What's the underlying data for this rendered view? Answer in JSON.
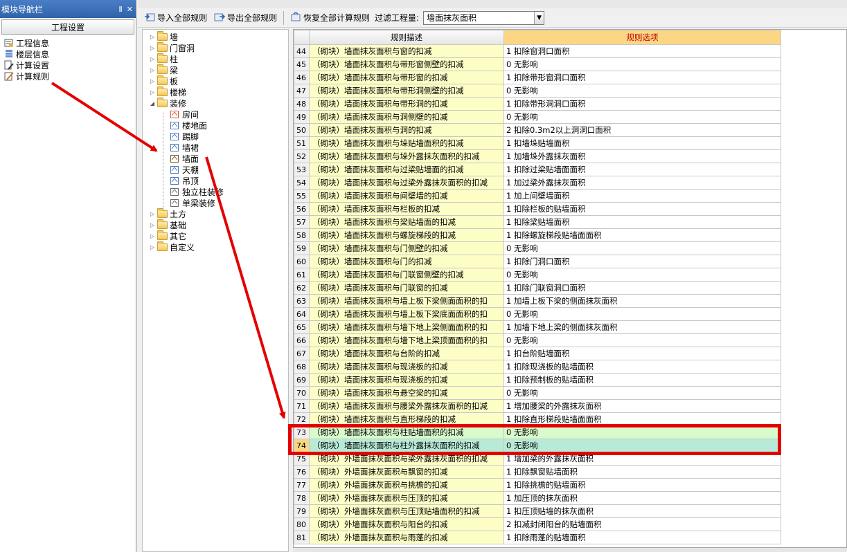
{
  "nav": {
    "title": "模块导航栏",
    "pin_glyph": "Ⅱ",
    "close_glyph": "✕",
    "header": "工程设置",
    "items": [
      {
        "label": "工程信息",
        "icon": "project-info-icon"
      },
      {
        "label": "楼层信息",
        "icon": "floor-info-icon"
      },
      {
        "label": "计算设置",
        "icon": "calc-settings-icon"
      },
      {
        "label": "计算规则",
        "icon": "calc-rules-icon"
      }
    ]
  },
  "toolbar": {
    "import_label": "导入全部规则",
    "export_label": "导出全部规则",
    "restore_label": "恢复全部计算规则",
    "filter_label": "过滤工程量:",
    "filter_value": "墙面抹灰面积"
  },
  "tree": {
    "top_items": [
      "墙",
      "门窗洞",
      "柱",
      "梁",
      "板",
      "楼梯"
    ],
    "expanded_item": "装修",
    "children": [
      {
        "label": "房间",
        "icon": "room-icon"
      },
      {
        "label": "楼地面",
        "icon": "floor-icon"
      },
      {
        "label": "踢脚",
        "icon": "skirting-icon"
      },
      {
        "label": "墙裙",
        "icon": "dado-icon"
      },
      {
        "label": "墙面",
        "icon": "wall-surface-icon"
      },
      {
        "label": "天棚",
        "icon": "ceiling-icon"
      },
      {
        "label": "吊顶",
        "icon": "suspended-ceiling-icon"
      },
      {
        "label": "独立柱装修",
        "icon": "column-decor-icon"
      },
      {
        "label": "单梁装修",
        "icon": "beam-decor-icon"
      }
    ],
    "bottom_items": [
      "土方",
      "基础",
      "其它",
      "自定义"
    ]
  },
  "grid": {
    "col_desc": "规则描述",
    "col_opt": "规则选项",
    "rows": [
      {
        "no": "44",
        "desc": "（砌块）墙面抹灰面积与窗的扣减",
        "opt": "1  扣除窗洞口面积"
      },
      {
        "no": "45",
        "desc": "（砌块）墙面抹灰面积与带形窗侧壁的扣减",
        "opt": "0  无影响"
      },
      {
        "no": "46",
        "desc": "（砌块）墙面抹灰面积与带形窗的扣减",
        "opt": "1  扣除带形窗洞口面积"
      },
      {
        "no": "47",
        "desc": "（砌块）墙面抹灰面积与带形洞侧壁的扣减",
        "opt": "0  无影响"
      },
      {
        "no": "48",
        "desc": "（砌块）墙面抹灰面积与带形洞的扣减",
        "opt": "1  扣除带形洞洞口面积"
      },
      {
        "no": "49",
        "desc": "（砌块）墙面抹灰面积与洞侧壁的扣减",
        "opt": "0  无影响"
      },
      {
        "no": "50",
        "desc": "（砌块）墙面抹灰面积与洞的扣减",
        "opt": "2  扣除0.3m2以上洞洞口面积"
      },
      {
        "no": "51",
        "desc": "（砌块）墙面抹灰面积与垛贴墙面积的扣减",
        "opt": "1  扣墙垛贴墙面积"
      },
      {
        "no": "52",
        "desc": "（砌块）墙面抹灰面积与垛外露抹灰面积的扣减",
        "opt": "1  加墙垛外露抹灰面积"
      },
      {
        "no": "53",
        "desc": "（砌块）墙面抹灰面积与过梁贴墙面的扣减",
        "opt": "1  扣除过梁贴墙面面积"
      },
      {
        "no": "54",
        "desc": "（砌块）墙面抹灰面积与过梁外露抹灰面积的扣减",
        "opt": "1  加过梁外露抹灰面积"
      },
      {
        "no": "55",
        "desc": "（砌块）墙面抹灰面积与间壁墙的扣减",
        "opt": "1  加上间壁墙面积"
      },
      {
        "no": "56",
        "desc": "（砌块）墙面抹灰面积与栏板的扣减",
        "opt": "1  扣除栏板的贴墙面积"
      },
      {
        "no": "57",
        "desc": "（砌块）墙面抹灰面积与梁贴墙面的扣减",
        "opt": "1  扣除梁贴墙面积"
      },
      {
        "no": "58",
        "desc": "（砌块）墙面抹灰面积与螺旋梯段的扣减",
        "opt": "1  扣除螺旋梯段贴墙面面积"
      },
      {
        "no": "59",
        "desc": "（砌块）墙面抹灰面积与门侧壁的扣减",
        "opt": "0  无影响"
      },
      {
        "no": "60",
        "desc": "（砌块）墙面抹灰面积与门的扣减",
        "opt": "1  扣除门洞口面积"
      },
      {
        "no": "61",
        "desc": "（砌块）墙面抹灰面积与门联窗侧壁的扣减",
        "opt": "0  无影响"
      },
      {
        "no": "62",
        "desc": "（砌块）墙面抹灰面积与门联窗的扣减",
        "opt": "1  扣除门联窗洞口面积"
      },
      {
        "no": "63",
        "desc": "（砌块）墙面抹灰面积与墙上板下梁侧面面积的扣",
        "opt": "1  加墙上板下梁的侧面抹灰面积"
      },
      {
        "no": "64",
        "desc": "（砌块）墙面抹灰面积与墙上板下梁底面面积的扣",
        "opt": "0  无影响"
      },
      {
        "no": "65",
        "desc": "（砌块）墙面抹灰面积与墙下地上梁侧面面积的扣",
        "opt": "1  加墙下地上梁的侧面抹灰面积"
      },
      {
        "no": "66",
        "desc": "（砌块）墙面抹灰面积与墙下地上梁顶面面积的扣",
        "opt": "0  无影响"
      },
      {
        "no": "67",
        "desc": "（砌块）墙面抹灰面积与台阶的扣减",
        "opt": "1  扣台阶贴墙面积"
      },
      {
        "no": "68",
        "desc": "（砌块）墙面抹灰面积与现浇板的扣减",
        "opt": "1  扣除现浇板的贴墙面积"
      },
      {
        "no": "69",
        "desc": "（砌块）墙面抹灰面积与现浇板的扣减",
        "opt": "1  扣除预制板的贴墙面积"
      },
      {
        "no": "70",
        "desc": "（砌块）墙面抹灰面积与悬空梁的扣减",
        "opt": "0  无影响"
      },
      {
        "no": "71",
        "desc": "（砌块）墙面抹灰面积与腰梁外露抹灰面积的扣减",
        "opt": "1  增加腰梁的外露抹灰面积"
      },
      {
        "no": "72",
        "desc": "（砌块）墙面抹灰面积与直形梯段的扣减",
        "opt": "1  扣除直形梯段贴墙面面积"
      },
      {
        "no": "73",
        "desc": "（砌块）墙面抹灰面积与柱贴墙面积的扣减",
        "opt": "0  无影响"
      },
      {
        "no": "74",
        "desc": "（砌块）墙面抹灰面积与柱外露抹灰面积的扣减",
        "opt": "0  无影响"
      },
      {
        "no": "75",
        "desc": "（砌块）外墙面抹灰面积与梁外露抹灰面积的扣减",
        "opt": "1  增加梁的外露抹灰面积"
      },
      {
        "no": "76",
        "desc": "（砌块）外墙面抹灰面积与飘窗的扣减",
        "opt": "1  扣除飘窗贴墙面积"
      },
      {
        "no": "77",
        "desc": "（砌块）外墙面抹灰面积与挑檐的扣减",
        "opt": "1  扣除挑檐的贴墙面积"
      },
      {
        "no": "78",
        "desc": "（砌块）外墙面抹灰面积与压顶的扣减",
        "opt": "1  加压顶的抹灰面积"
      },
      {
        "no": "79",
        "desc": "（砌块）外墙面抹灰面积与压顶贴墙面积的扣减",
        "opt": "1  扣压顶贴墙的抹灰面积"
      },
      {
        "no": "80",
        "desc": "（砌块）外墙面抹灰面积与阳台的扣减",
        "opt": "2  扣减封闭阳台的贴墙面积"
      },
      {
        "no": "81",
        "desc": "（砌块）外墙面抹灰面积与雨蓬的扣减",
        "opt": "1  扣除雨蓬的贴墙面积"
      }
    ],
    "highlight_rows": [
      "73",
      "74"
    ],
    "current_row": "74"
  },
  "annotation": {
    "color": "#e40000"
  }
}
